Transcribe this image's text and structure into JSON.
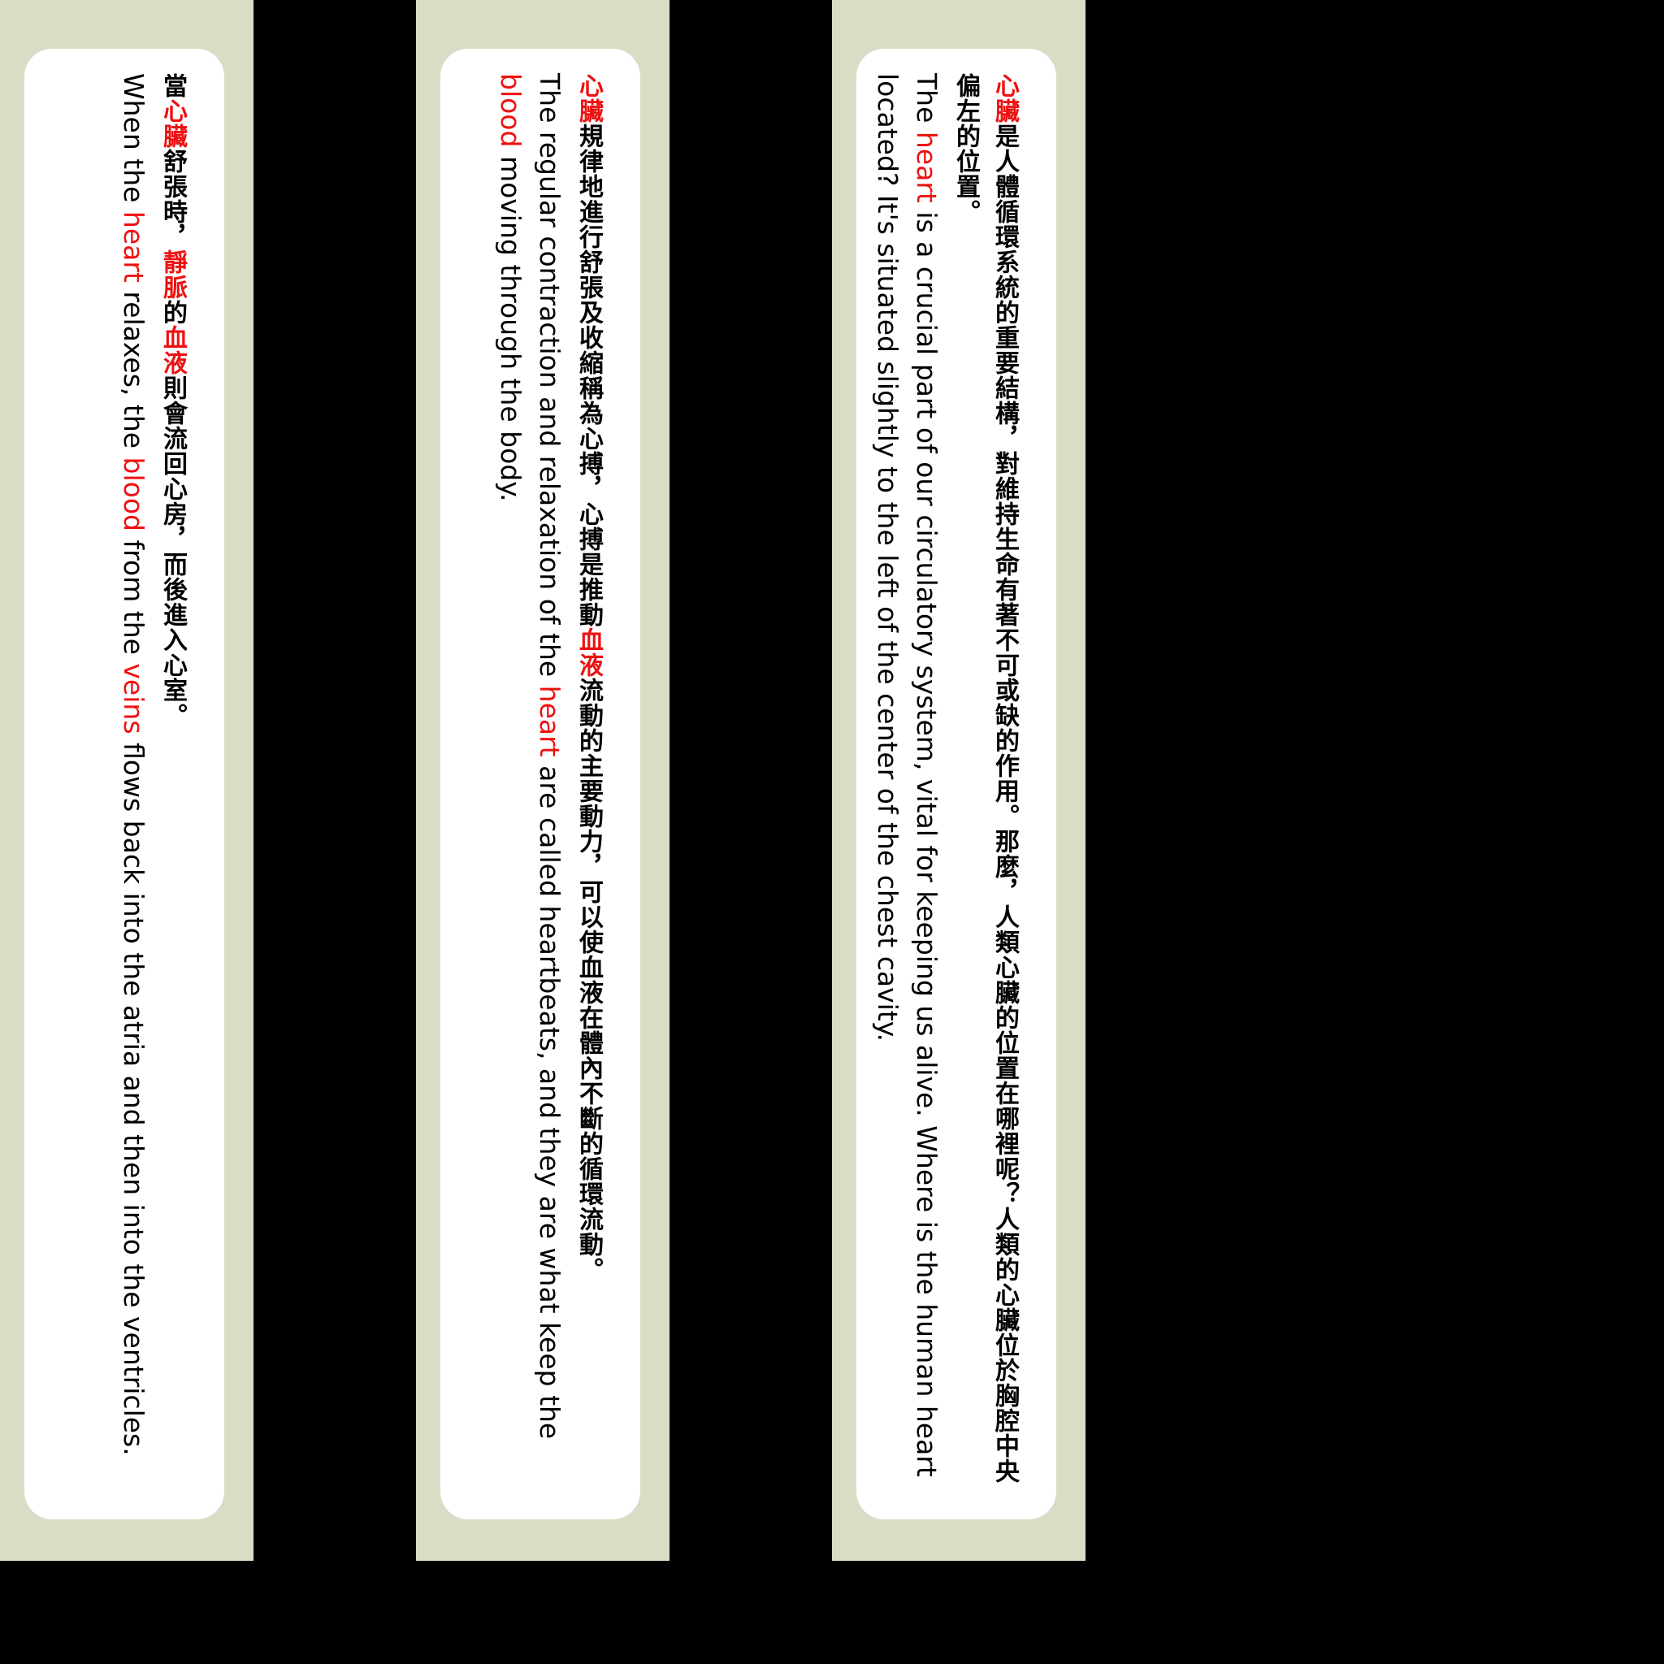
{
  "highlight_color": "#ee1111",
  "panel_color": "#d9ddc5",
  "cards": [
    {
      "zh": [
        {
          "t": "當",
          "h": false
        },
        {
          "t": "心臟",
          "h": true
        },
        {
          "t": "舒張時，",
          "h": false
        },
        {
          "t": "靜脈",
          "h": true
        },
        {
          "t": "的",
          "h": false
        },
        {
          "t": "血液",
          "h": true
        },
        {
          "t": "則會流回心房，而後進入心室。",
          "h": false
        }
      ],
      "en": [
        {
          "t": "When the ",
          "h": false
        },
        {
          "t": "heart",
          "h": true
        },
        {
          "t": " relaxes, the ",
          "h": false
        },
        {
          "t": "blood",
          "h": true
        },
        {
          "t": " from the ",
          "h": false
        },
        {
          "t": "veins",
          "h": true
        },
        {
          "t": " flows back into the atria and then into the ventricles.",
          "h": false
        }
      ]
    },
    {
      "zh": [
        {
          "t": "心臟",
          "h": true
        },
        {
          "t": "規律地進行舒張及收縮稱為心搏，心搏是推動",
          "h": false
        },
        {
          "t": "血液",
          "h": true
        },
        {
          "t": "流動的主要動力，可以使血液在體內不斷的循環流動。",
          "h": false
        }
      ],
      "en": [
        {
          "t": "The regular contraction and relaxation of the ",
          "h": false
        },
        {
          "t": "heart",
          "h": true
        },
        {
          "t": " are called heartbeats, and they are what keep the ",
          "h": false
        },
        {
          "t": "blood",
          "h": true
        },
        {
          "t": " moving through the body.",
          "h": false
        }
      ]
    },
    {
      "zh": [
        {
          "t": "心臟",
          "h": true
        },
        {
          "t": "是人體循環系統的重要結構，對維持生命有著不可或缺的作用。那麼，人類心臟的位置在哪裡呢？人類的心臟位於胸腔中央偏左的位置。",
          "h": false
        }
      ],
      "en": [
        {
          "t": "The ",
          "h": false
        },
        {
          "t": "heart",
          "h": true
        },
        {
          "t": " is a crucial part of our circulatory system, vital for keeping us alive. Where is the human heart located? It's situated slightly to the left of the center of the chest cavity.",
          "h": false
        }
      ]
    }
  ]
}
